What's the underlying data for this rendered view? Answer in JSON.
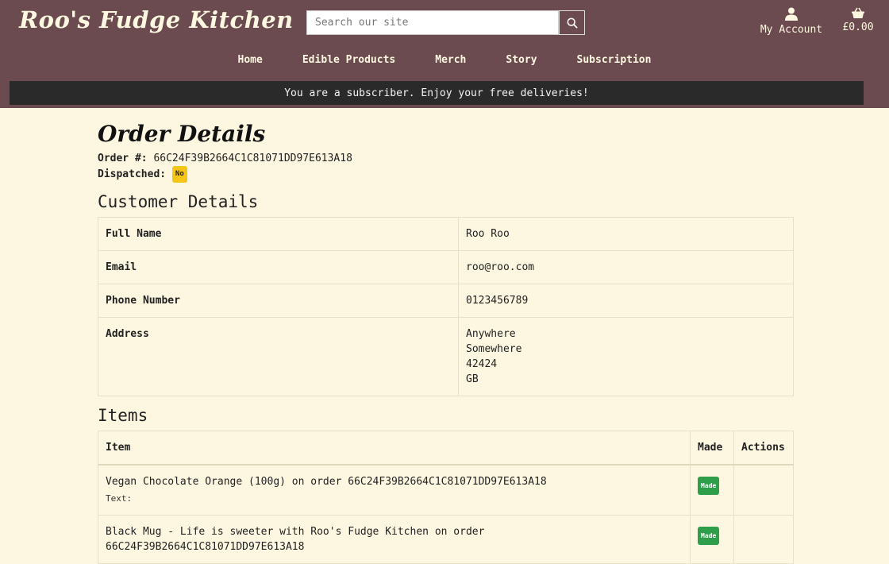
{
  "header": {
    "logo": "Roo's Fudge Kitchen",
    "search": {
      "placeholder": "Search our site",
      "value": ""
    },
    "account_label": "My Account",
    "basket_total": "£0.00"
  },
  "nav": {
    "items": [
      {
        "label": "Home"
      },
      {
        "label": "Edible Products"
      },
      {
        "label": "Merch"
      },
      {
        "label": "Story"
      },
      {
        "label": "Subscription"
      }
    ]
  },
  "banner": {
    "text": "You are a subscriber. Enjoy your free deliveries!"
  },
  "order": {
    "title": "Order Details",
    "number_label": "Order #:",
    "number": "66C24F39B2664C1C81071DD97E613A18",
    "dispatched_label": "Dispatched:",
    "dispatched_value": "No"
  },
  "customer": {
    "title": "Customer Details",
    "rows": [
      {
        "label": "Full Name",
        "value": "Roo Roo"
      },
      {
        "label": "Email",
        "value": "roo@roo.com"
      },
      {
        "label": "Phone Number",
        "value": "0123456789"
      }
    ],
    "address_label": "Address",
    "address_lines": [
      "Anywhere",
      "Somewhere",
      "42424",
      "GB"
    ]
  },
  "items": {
    "title": "Items",
    "headers": [
      "Item",
      "Made",
      "Actions"
    ],
    "rows": [
      {
        "name": "Vegan Chocolate Orange (100g) on order 66C24F39B2664C1C81071DD97E613A18",
        "text_label": "Text:",
        "made": "Made",
        "actions": ""
      },
      {
        "name": "Black Mug - Life is sweeter with Roo's Fudge Kitchen on order 66C24F39B2664C1C81071DD97E613A18",
        "text_label": "",
        "made": "Made",
        "actions": ""
      }
    ]
  },
  "colors": {
    "header_bg": "#6b4a50",
    "page_bg": "#fdf6e0",
    "banner_bg": "#2a2a2a",
    "dispatched_badge": "#f5c518",
    "made_badge": "#2e9e4a"
  }
}
